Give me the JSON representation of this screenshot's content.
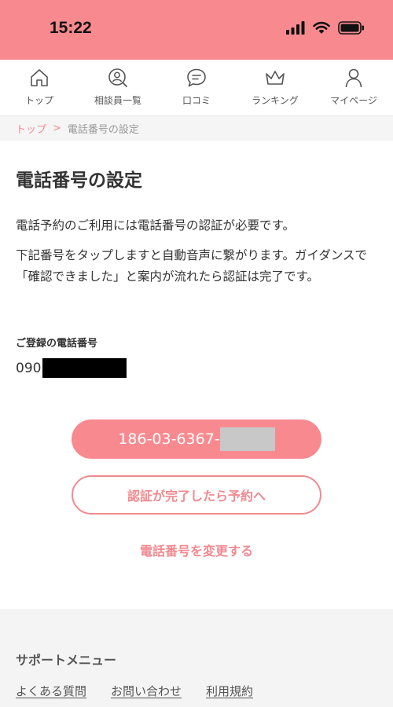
{
  "status_bar": {
    "time": "15:22",
    "icons": [
      "signal-icon",
      "wifi-icon",
      "battery-icon"
    ]
  },
  "nav": {
    "items": [
      {
        "label": "トップ",
        "icon": "home-icon"
      },
      {
        "label": "相談員一覧",
        "icon": "counselor-search-icon"
      },
      {
        "label": "口コミ",
        "icon": "chat-bubble-icon"
      },
      {
        "label": "ランキング",
        "icon": "crown-icon"
      },
      {
        "label": "マイページ",
        "icon": "user-icon"
      }
    ]
  },
  "breadcrumb": {
    "home": "トップ",
    "separator": ">",
    "current": "電話番号の設定"
  },
  "main": {
    "title": "電話番号の設定",
    "desc1": "電話予約のご利用には電話番号の認証が必要です。",
    "desc2": "下記番号をタップしますと自動音声に繋がります。ガイダンスで「確認できました」と案内が流れたら認証は完了です。",
    "registered_label": "ご登録の電話番号",
    "registered_prefix": "090",
    "phone_button_prefix": "186-03-6367-",
    "done_button": "認証が完了したら予約へ",
    "change_link": "電話番号を変更する"
  },
  "support": {
    "title": "サポートメニュー",
    "links": [
      "よくある質問",
      "お問い合わせ",
      "利用規約"
    ]
  },
  "colors": {
    "accent": "#f88a8f",
    "accent_text": "#f08a90"
  }
}
